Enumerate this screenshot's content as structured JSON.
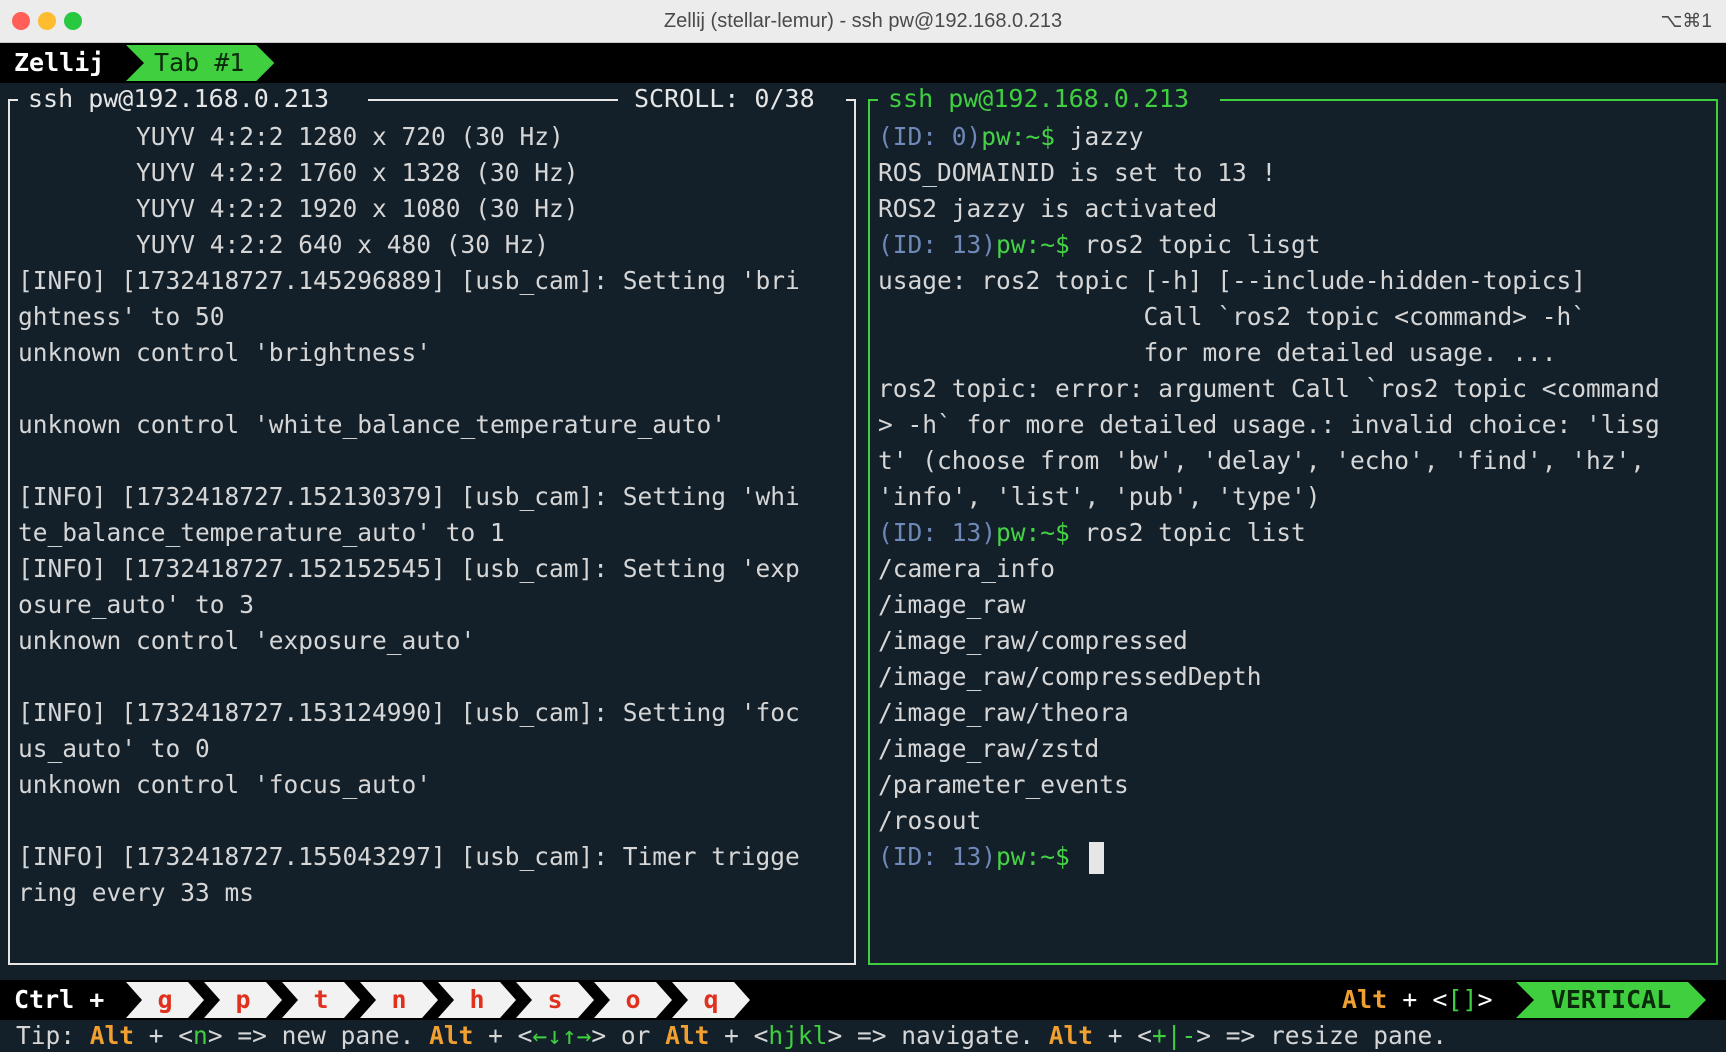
{
  "window": {
    "title": "Zellij (stellar-lemur) - ssh pw@192.168.0.213",
    "shortcut": "⌥⌘1",
    "colors": {
      "close": "#ff5f57",
      "minimize": "#febc2e",
      "zoom": "#28c840"
    }
  },
  "tabbar": {
    "brand": "Zellij",
    "tabs": [
      {
        "label": "Tab #1"
      }
    ]
  },
  "left_pane": {
    "title": "ssh pw@192.168.0.213",
    "scroll": "SCROLL:  0/38",
    "lines": [
      "        YUYV 4:2:2 1280 x 720 (30 Hz)",
      "        YUYV 4:2:2 1760 x 1328 (30 Hz)",
      "        YUYV 4:2:2 1920 x 1080 (30 Hz)",
      "        YUYV 4:2:2 640 x 480 (30 Hz)",
      "[INFO] [1732418727.145296889] [usb_cam]: Setting 'bri",
      "ghtness' to 50",
      "unknown control 'brightness'",
      "",
      "unknown control 'white_balance_temperature_auto'",
      "",
      "[INFO] [1732418727.152130379] [usb_cam]: Setting 'whi",
      "te_balance_temperature_auto' to 1",
      "[INFO] [1732418727.152152545] [usb_cam]: Setting 'exp",
      "osure_auto' to 3",
      "unknown control 'exposure_auto'",
      "",
      "[INFO] [1732418727.153124990] [usb_cam]: Setting 'foc",
      "us_auto' to 0",
      "unknown control 'focus_auto'",
      "",
      "[INFO] [1732418727.155043297] [usb_cam]: Timer trigge",
      "ring every 33 ms"
    ]
  },
  "right_pane": {
    "title": "ssh pw@192.168.0.213",
    "prompt_user": "pw:~$",
    "lines": [
      {
        "id": "(ID: 0)",
        "cmd": " jazzy"
      },
      {
        "text": "ROS_DOMAINID is set to 13 !"
      },
      {
        "text": "ROS2 jazzy is activated"
      },
      {
        "id": "(ID: 13)",
        "cmd": " ros2 topic lisgt"
      },
      {
        "text": "usage: ros2 topic [-h] [--include-hidden-topics]"
      },
      {
        "text": "                  Call `ros2 topic <command> -h`"
      },
      {
        "text": "                  for more detailed usage. ..."
      },
      {
        "text": "ros2 topic: error: argument Call `ros2 topic <command"
      },
      {
        "text": "> -h` for more detailed usage.: invalid choice: 'lisg"
      },
      {
        "text": "t' (choose from 'bw', 'delay', 'echo', 'find', 'hz',"
      },
      {
        "text": "'info', 'list', 'pub', 'type')"
      },
      {
        "id": "(ID: 13)",
        "cmd": " ros2 topic list"
      },
      {
        "text": "/camera_info"
      },
      {
        "text": "/image_raw"
      },
      {
        "text": "/image_raw/compressed"
      },
      {
        "text": "/image_raw/compressedDepth"
      },
      {
        "text": "/image_raw/theora"
      },
      {
        "text": "/image_raw/zstd"
      },
      {
        "text": "/parameter_events"
      },
      {
        "text": "/rosout"
      },
      {
        "id": "(ID: 13)",
        "cmd": " ",
        "cursor": true
      }
    ]
  },
  "statusbar": {
    "ctrl_label": "Ctrl +",
    "keys": [
      "g",
      "p",
      "t",
      "n",
      "h",
      "s",
      "o",
      "q"
    ],
    "alt_label": "Alt",
    "plus": " + ",
    "alt_keys_open": "<",
    "alt_keys": "[]",
    "alt_keys_close": ">",
    "mode": "VERTICAL"
  },
  "tip": {
    "prefix": "Tip: ",
    "alt": "Alt",
    "s1": " + <",
    "k1": "n",
    "s2": "> => new pane. ",
    "s3": " + <",
    "k2": "←↓↑→",
    "s4": "> or ",
    "s5": " + <",
    "k3": "hjkl",
    "s6": "> => navigate. ",
    "s7": " + <",
    "k4": "+|-",
    "s8": "> => resize pane."
  }
}
